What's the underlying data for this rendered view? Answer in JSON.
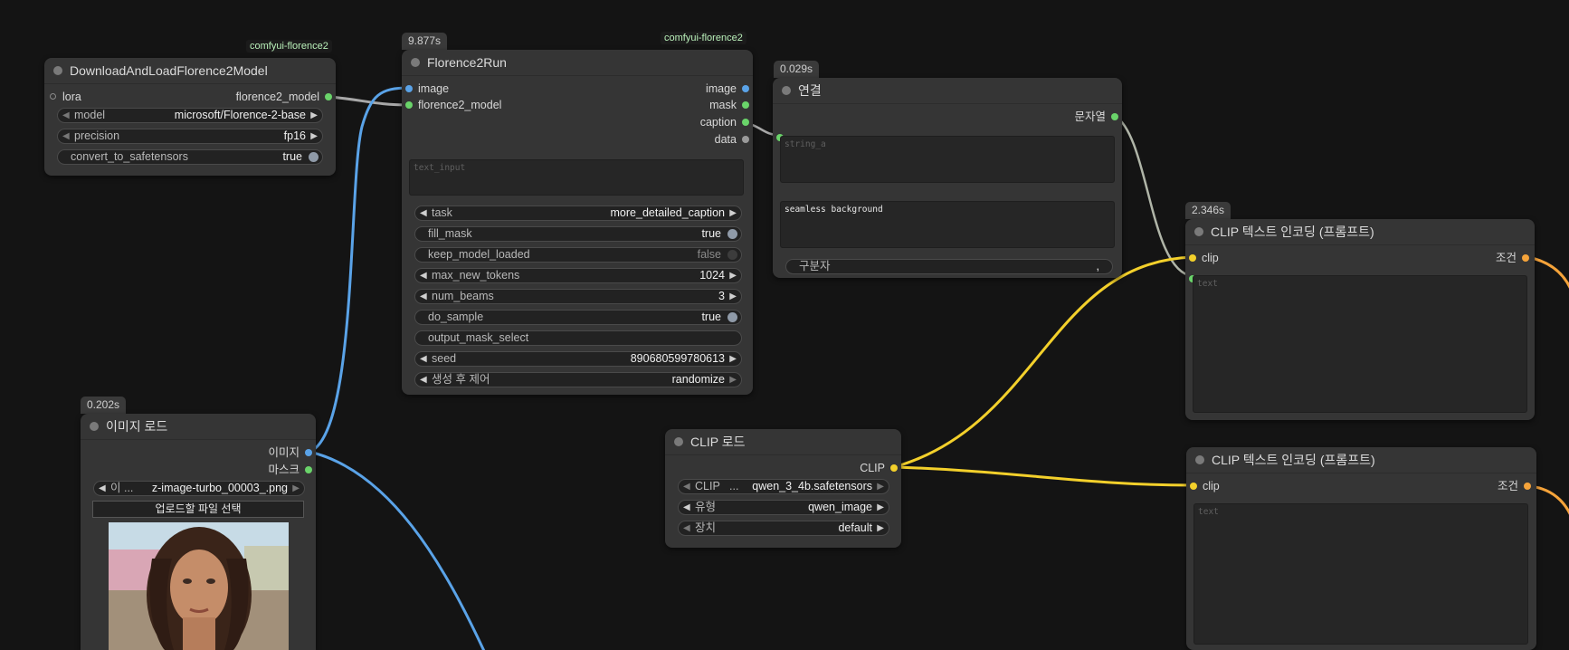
{
  "nodes": {
    "download_model": {
      "source_tag": "comfyui-florence2",
      "title": "DownloadAndLoadFlorence2Model",
      "inputs": [
        "lora"
      ],
      "outputs": [
        "florence2_model"
      ],
      "widgets": {
        "model": {
          "label": "model",
          "value": "microsoft/Florence-2-base"
        },
        "precision": {
          "label": "precision",
          "value": "fp16"
        },
        "convert": {
          "label": "convert_to_safetensors",
          "value": "true"
        }
      }
    },
    "florence_run": {
      "time": "9.877s",
      "source_tag": "comfyui-florence2",
      "title": "Florence2Run",
      "inputs": [
        "image",
        "florence2_model"
      ],
      "outputs": [
        "image",
        "mask",
        "caption",
        "data"
      ],
      "text_input_placeholder": "text_input",
      "widgets": {
        "task": {
          "label": "task",
          "value": "more_detailed_caption"
        },
        "fill_mask": {
          "label": "fill_mask",
          "value": "true"
        },
        "keep_model_loaded": {
          "label": "keep_model_loaded",
          "value": "false"
        },
        "max_new_tokens": {
          "label": "max_new_tokens",
          "value": "1024"
        },
        "num_beams": {
          "label": "num_beams",
          "value": "3"
        },
        "do_sample": {
          "label": "do_sample",
          "value": "true"
        },
        "output_mask_select": {
          "label": "output_mask_select",
          "value": ""
        },
        "seed": {
          "label": "seed",
          "value": "890680599780613"
        },
        "control": {
          "label": "생성 후 제어",
          "value": "randomize"
        }
      }
    },
    "concat": {
      "time": "0.029s",
      "title": "연결",
      "outputs": [
        "문자열"
      ],
      "string_a_placeholder": "string_a",
      "string_b_value": "seamless background",
      "delimiter_label": "구분자",
      "delimiter_value": ","
    },
    "clip_encode_1": {
      "time": "2.346s",
      "title": "CLIP 텍스트 인코딩 (프롬프트)",
      "input": "clip",
      "output": "조건",
      "text_placeholder": "text"
    },
    "clip_encode_2": {
      "title": "CLIP 텍스트 인코딩 (프롬프트)",
      "input": "clip",
      "output": "조건",
      "text_placeholder": "text"
    },
    "clip_load": {
      "title": "CLIP 로드",
      "outputs": [
        "CLIP"
      ],
      "widgets": {
        "clip": {
          "label": "CLIP",
          "prefix": "...",
          "value": "qwen_3_4b.safetensors"
        },
        "type": {
          "label": "유형",
          "value": "qwen_image"
        },
        "device": {
          "label": "장치",
          "value": "default"
        }
      }
    },
    "image_load": {
      "time": "0.202s",
      "title": "이미지 로드",
      "outputs": [
        "이미지",
        "마스크"
      ],
      "image_widget": {
        "label": "이 ...",
        "value": "z-image-turbo_00003_.png"
      },
      "upload_label": "업로드할 파일 선택",
      "preview_icon": "portrait-image"
    }
  },
  "colors": {
    "background": "#141414",
    "node": "#353535",
    "image_wire": "#5aa3e8",
    "model_wire": "#a8a8a8",
    "clip_wire": "#f3d02b",
    "conditioning_wire": "#f5a33a",
    "string_wire": "#b0b5a8"
  }
}
